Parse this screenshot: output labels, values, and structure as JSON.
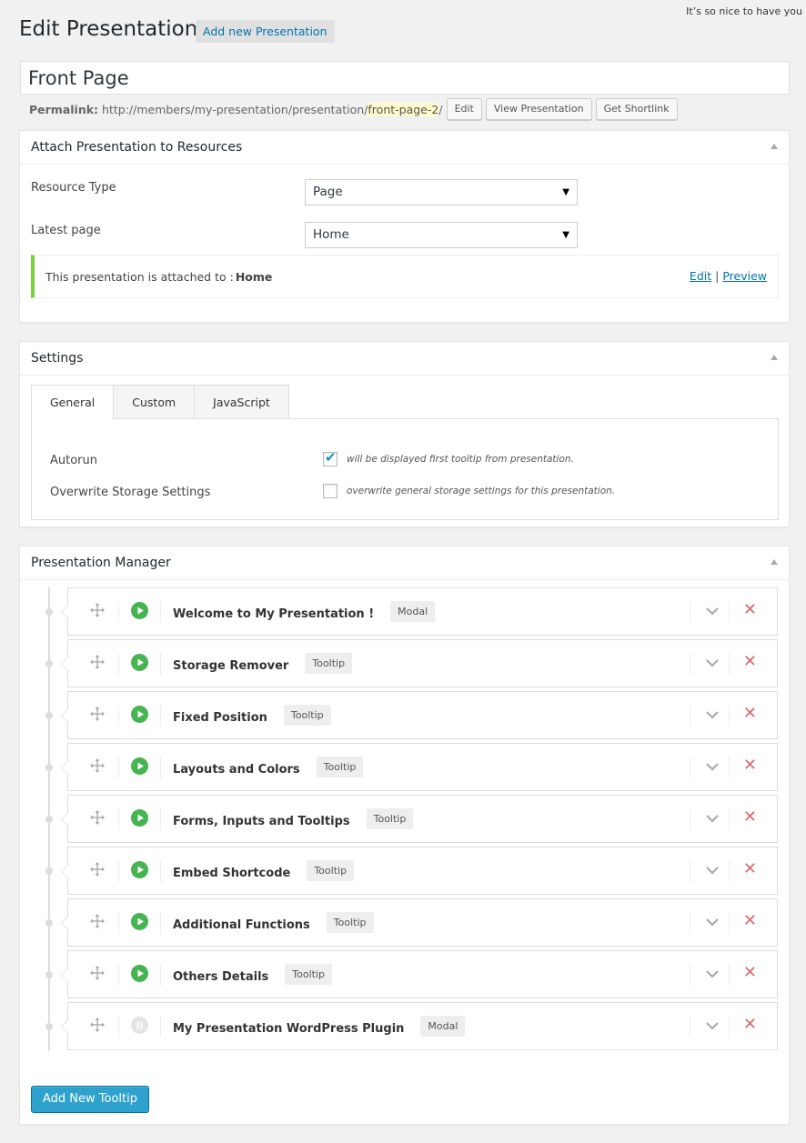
{
  "header": {
    "greeting": "It’s so nice to have you",
    "title": "Edit Presentation",
    "add_new_label": "Add new Presentation"
  },
  "post": {
    "title_value": "Front Page",
    "permalink_label": "Permalink:",
    "permalink_base": "http://members/my-presentation/presentation/",
    "permalink_slug": "front-page-2",
    "permalink_end": "/",
    "buttons": {
      "edit": "Edit",
      "view": "View Presentation",
      "shortlink": "Get Shortlink"
    }
  },
  "attach_box": {
    "title": "Attach Presentation to Resources",
    "resource_type_label": "Resource Type",
    "resource_type_value": "Page",
    "latest_page_label": "Latest page",
    "latest_page_value": "Home",
    "notice_text": "This presentation is attached to :",
    "notice_target": "Home",
    "notice_edit": "Edit",
    "notice_separator": "|",
    "notice_preview": "Preview"
  },
  "settings_box": {
    "title": "Settings",
    "tabs": [
      "General",
      "Custom",
      "JavaScript"
    ],
    "active_tab": "General",
    "autorun_label": "Autorun",
    "autorun_checked": true,
    "autorun_desc": "will be displayed first tooltip from presentation.",
    "storage_label": "Overwrite Storage Settings",
    "storage_checked": false,
    "storage_desc": "overwrite general storage settings for this presentation."
  },
  "manager_box": {
    "title": "Presentation Manager",
    "add_button": "Add New Tooltip",
    "items": [
      {
        "title": "Welcome to My Presentation !",
        "type": "Modal",
        "active": true
      },
      {
        "title": "Storage Remover",
        "type": "Tooltip",
        "active": true
      },
      {
        "title": "Fixed Position",
        "type": "Tooltip",
        "active": true
      },
      {
        "title": "Layouts and Colors",
        "type": "Tooltip",
        "active": true
      },
      {
        "title": "Forms, Inputs and Tooltips",
        "type": "Tooltip",
        "active": true
      },
      {
        "title": "Embed Shortcode",
        "type": "Tooltip",
        "active": true
      },
      {
        "title": "Additional Functions",
        "type": "Tooltip",
        "active": true
      },
      {
        "title": "Others Details",
        "type": "Tooltip",
        "active": true
      },
      {
        "title": "My Presentation WordPress Plugin",
        "type": "Modal",
        "active": false
      }
    ]
  },
  "colors": {
    "accent": "#0073aa",
    "play_active": "#46b450",
    "play_inactive": "#e5e5e5",
    "delete": "#d9686b",
    "notice_border": "#7ad03a",
    "primary_button": "#2ea2cc"
  }
}
